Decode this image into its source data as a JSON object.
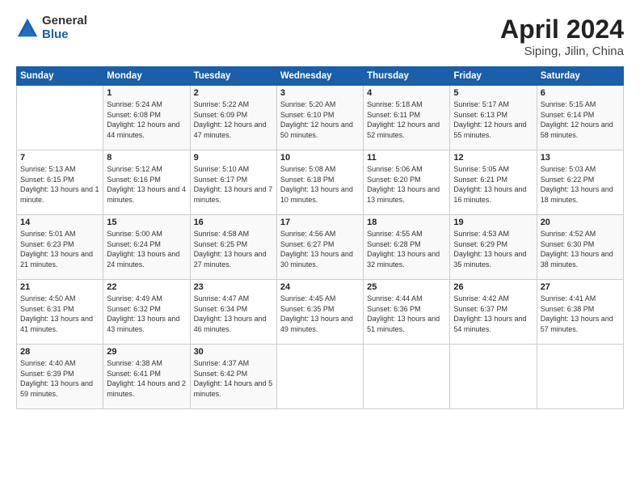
{
  "logo": {
    "general": "General",
    "blue": "Blue"
  },
  "title": {
    "month": "April 2024",
    "location": "Siping, Jilin, China"
  },
  "headers": [
    "Sunday",
    "Monday",
    "Tuesday",
    "Wednesday",
    "Thursday",
    "Friday",
    "Saturday"
  ],
  "weeks": [
    [
      {
        "day": "",
        "sunrise": "",
        "sunset": "",
        "daylight": ""
      },
      {
        "day": "1",
        "sunrise": "Sunrise: 5:24 AM",
        "sunset": "Sunset: 6:08 PM",
        "daylight": "Daylight: 12 hours and 44 minutes."
      },
      {
        "day": "2",
        "sunrise": "Sunrise: 5:22 AM",
        "sunset": "Sunset: 6:09 PM",
        "daylight": "Daylight: 12 hours and 47 minutes."
      },
      {
        "day": "3",
        "sunrise": "Sunrise: 5:20 AM",
        "sunset": "Sunset: 6:10 PM",
        "daylight": "Daylight: 12 hours and 50 minutes."
      },
      {
        "day": "4",
        "sunrise": "Sunrise: 5:18 AM",
        "sunset": "Sunset: 6:11 PM",
        "daylight": "Daylight: 12 hours and 52 minutes."
      },
      {
        "day": "5",
        "sunrise": "Sunrise: 5:17 AM",
        "sunset": "Sunset: 6:13 PM",
        "daylight": "Daylight: 12 hours and 55 minutes."
      },
      {
        "day": "6",
        "sunrise": "Sunrise: 5:15 AM",
        "sunset": "Sunset: 6:14 PM",
        "daylight": "Daylight: 12 hours and 58 minutes."
      }
    ],
    [
      {
        "day": "7",
        "sunrise": "Sunrise: 5:13 AM",
        "sunset": "Sunset: 6:15 PM",
        "daylight": "Daylight: 13 hours and 1 minute."
      },
      {
        "day": "8",
        "sunrise": "Sunrise: 5:12 AM",
        "sunset": "Sunset: 6:16 PM",
        "daylight": "Daylight: 13 hours and 4 minutes."
      },
      {
        "day": "9",
        "sunrise": "Sunrise: 5:10 AM",
        "sunset": "Sunset: 6:17 PM",
        "daylight": "Daylight: 13 hours and 7 minutes."
      },
      {
        "day": "10",
        "sunrise": "Sunrise: 5:08 AM",
        "sunset": "Sunset: 6:18 PM",
        "daylight": "Daylight: 13 hours and 10 minutes."
      },
      {
        "day": "11",
        "sunrise": "Sunrise: 5:06 AM",
        "sunset": "Sunset: 6:20 PM",
        "daylight": "Daylight: 13 hours and 13 minutes."
      },
      {
        "day": "12",
        "sunrise": "Sunrise: 5:05 AM",
        "sunset": "Sunset: 6:21 PM",
        "daylight": "Daylight: 13 hours and 16 minutes."
      },
      {
        "day": "13",
        "sunrise": "Sunrise: 5:03 AM",
        "sunset": "Sunset: 6:22 PM",
        "daylight": "Daylight: 13 hours and 18 minutes."
      }
    ],
    [
      {
        "day": "14",
        "sunrise": "Sunrise: 5:01 AM",
        "sunset": "Sunset: 6:23 PM",
        "daylight": "Daylight: 13 hours and 21 minutes."
      },
      {
        "day": "15",
        "sunrise": "Sunrise: 5:00 AM",
        "sunset": "Sunset: 6:24 PM",
        "daylight": "Daylight: 13 hours and 24 minutes."
      },
      {
        "day": "16",
        "sunrise": "Sunrise: 4:58 AM",
        "sunset": "Sunset: 6:25 PM",
        "daylight": "Daylight: 13 hours and 27 minutes."
      },
      {
        "day": "17",
        "sunrise": "Sunrise: 4:56 AM",
        "sunset": "Sunset: 6:27 PM",
        "daylight": "Daylight: 13 hours and 30 minutes."
      },
      {
        "day": "18",
        "sunrise": "Sunrise: 4:55 AM",
        "sunset": "Sunset: 6:28 PM",
        "daylight": "Daylight: 13 hours and 32 minutes."
      },
      {
        "day": "19",
        "sunrise": "Sunrise: 4:53 AM",
        "sunset": "Sunset: 6:29 PM",
        "daylight": "Daylight: 13 hours and 35 minutes."
      },
      {
        "day": "20",
        "sunrise": "Sunrise: 4:52 AM",
        "sunset": "Sunset: 6:30 PM",
        "daylight": "Daylight: 13 hours and 38 minutes."
      }
    ],
    [
      {
        "day": "21",
        "sunrise": "Sunrise: 4:50 AM",
        "sunset": "Sunset: 6:31 PM",
        "daylight": "Daylight: 13 hours and 41 minutes."
      },
      {
        "day": "22",
        "sunrise": "Sunrise: 4:49 AM",
        "sunset": "Sunset: 6:32 PM",
        "daylight": "Daylight: 13 hours and 43 minutes."
      },
      {
        "day": "23",
        "sunrise": "Sunrise: 4:47 AM",
        "sunset": "Sunset: 6:34 PM",
        "daylight": "Daylight: 13 hours and 46 minutes."
      },
      {
        "day": "24",
        "sunrise": "Sunrise: 4:45 AM",
        "sunset": "Sunset: 6:35 PM",
        "daylight": "Daylight: 13 hours and 49 minutes."
      },
      {
        "day": "25",
        "sunrise": "Sunrise: 4:44 AM",
        "sunset": "Sunset: 6:36 PM",
        "daylight": "Daylight: 13 hours and 51 minutes."
      },
      {
        "day": "26",
        "sunrise": "Sunrise: 4:42 AM",
        "sunset": "Sunset: 6:37 PM",
        "daylight": "Daylight: 13 hours and 54 minutes."
      },
      {
        "day": "27",
        "sunrise": "Sunrise: 4:41 AM",
        "sunset": "Sunset: 6:38 PM",
        "daylight": "Daylight: 13 hours and 57 minutes."
      }
    ],
    [
      {
        "day": "28",
        "sunrise": "Sunrise: 4:40 AM",
        "sunset": "Sunset: 6:39 PM",
        "daylight": "Daylight: 13 hours and 59 minutes."
      },
      {
        "day": "29",
        "sunrise": "Sunrise: 4:38 AM",
        "sunset": "Sunset: 6:41 PM",
        "daylight": "Daylight: 14 hours and 2 minutes."
      },
      {
        "day": "30",
        "sunrise": "Sunrise: 4:37 AM",
        "sunset": "Sunset: 6:42 PM",
        "daylight": "Daylight: 14 hours and 5 minutes."
      },
      {
        "day": "",
        "sunrise": "",
        "sunset": "",
        "daylight": ""
      },
      {
        "day": "",
        "sunrise": "",
        "sunset": "",
        "daylight": ""
      },
      {
        "day": "",
        "sunrise": "",
        "sunset": "",
        "daylight": ""
      },
      {
        "day": "",
        "sunrise": "",
        "sunset": "",
        "daylight": ""
      }
    ]
  ]
}
